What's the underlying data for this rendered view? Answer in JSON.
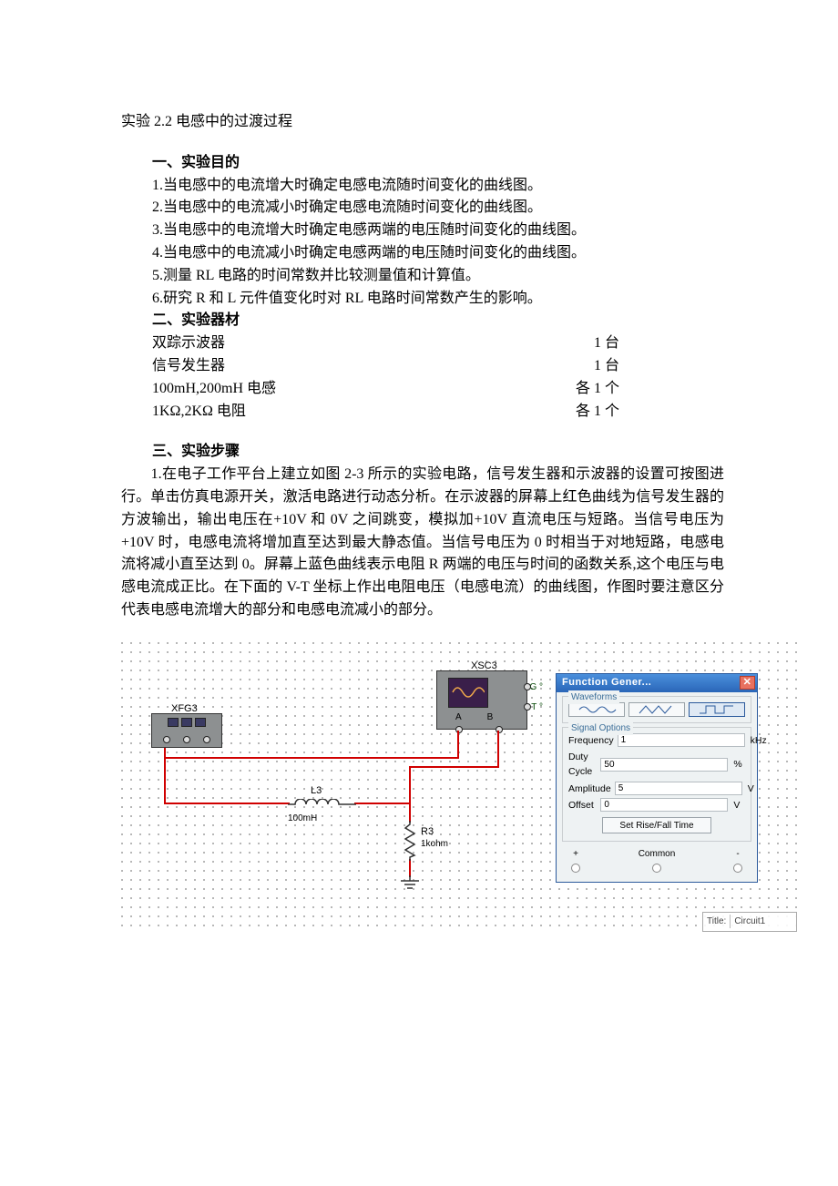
{
  "doc": {
    "title": "实验 2.2 电感中的过渡过程",
    "section1_heading": "一、实验目的",
    "goals": [
      "1.当电感中的电流增大时确定电感电流随时间变化的曲线图。",
      "2.当电感中的电流减小时确定电感电流随时间变化的曲线图。",
      "3.当电感中的电流增大时确定电感两端的电压随时间变化的曲线图。",
      "4.当电感中的电流减小时确定电感两端的电压随时间变化的曲线图。",
      "5.测量 RL 电路的时间常数并比较测量值和计算值。",
      "6.研究 R 和 L 元件值变化时对 RL 电路时间常数产生的影响。"
    ],
    "section2_heading": "二、实验器材",
    "equipment": [
      {
        "name": "双踪示波器",
        "qty": "1 台"
      },
      {
        "name": "信号发生器",
        "qty": "1 台"
      },
      {
        "name": "100mH,200mH 电感",
        "qty": "各 1 个"
      },
      {
        "name": "1KΩ,2KΩ 电阻",
        "qty": "各 1 个"
      }
    ],
    "section3_heading": "三、实验步骤",
    "step1_text": "　　1.在电子工作平台上建立如图 2-3 所示的实验电路，信号发生器和示波器的设置可按图进行。单击仿真电源开关，激活电路进行动态分析。在示波器的屏幕上红色曲线为信号发生器的方波输出，输出电压在+10V 和 0V 之间跳变，模拟加+10V 直流电压与短路。当信号电压为+10V 时，电感电流将增加直至达到最大静态值。当信号电压为 0 时相当于对地短路，电感电流将减小直至达到 0。屏幕上蓝色曲线表示电阻 R 两端的电压与时间的函数关系,这个电压与电感电流成正比。在下面的 V-T 坐标上作出电阻电压（电感电流）的曲线图，作图时要注意区分代表电感电流增大的部分和电感电流减小的部分。"
  },
  "circuit": {
    "xfg3_label": "XFG3",
    "xsc3_label": "XSC3",
    "scope_g": "G °",
    "scope_t": "T °",
    "scope_a": "A",
    "scope_b": "B",
    "l3_name": "L3",
    "l3_value": "100mH",
    "r3_name": "R3",
    "r3_value": "1kohm",
    "canvas_title_label": "Title:",
    "canvas_title_value": "Circuit1"
  },
  "dialog": {
    "title": "Function Gener...",
    "waveforms_label": "Waveforms",
    "signal_label": "Signal Options",
    "freq_label": "Frequency",
    "freq_value": "1",
    "freq_unit": "kHz",
    "duty_label": "Duty Cycle",
    "duty_value": "50",
    "duty_unit": "%",
    "amp_label": "Amplitude",
    "amp_value": "5",
    "amp_unit": "V",
    "off_label": "Offset",
    "off_value": "0",
    "off_unit": "V",
    "rise_btn": "Set Rise/Fall Time",
    "foot_plus": "+",
    "foot_common": "Common",
    "foot_minus": "-"
  }
}
